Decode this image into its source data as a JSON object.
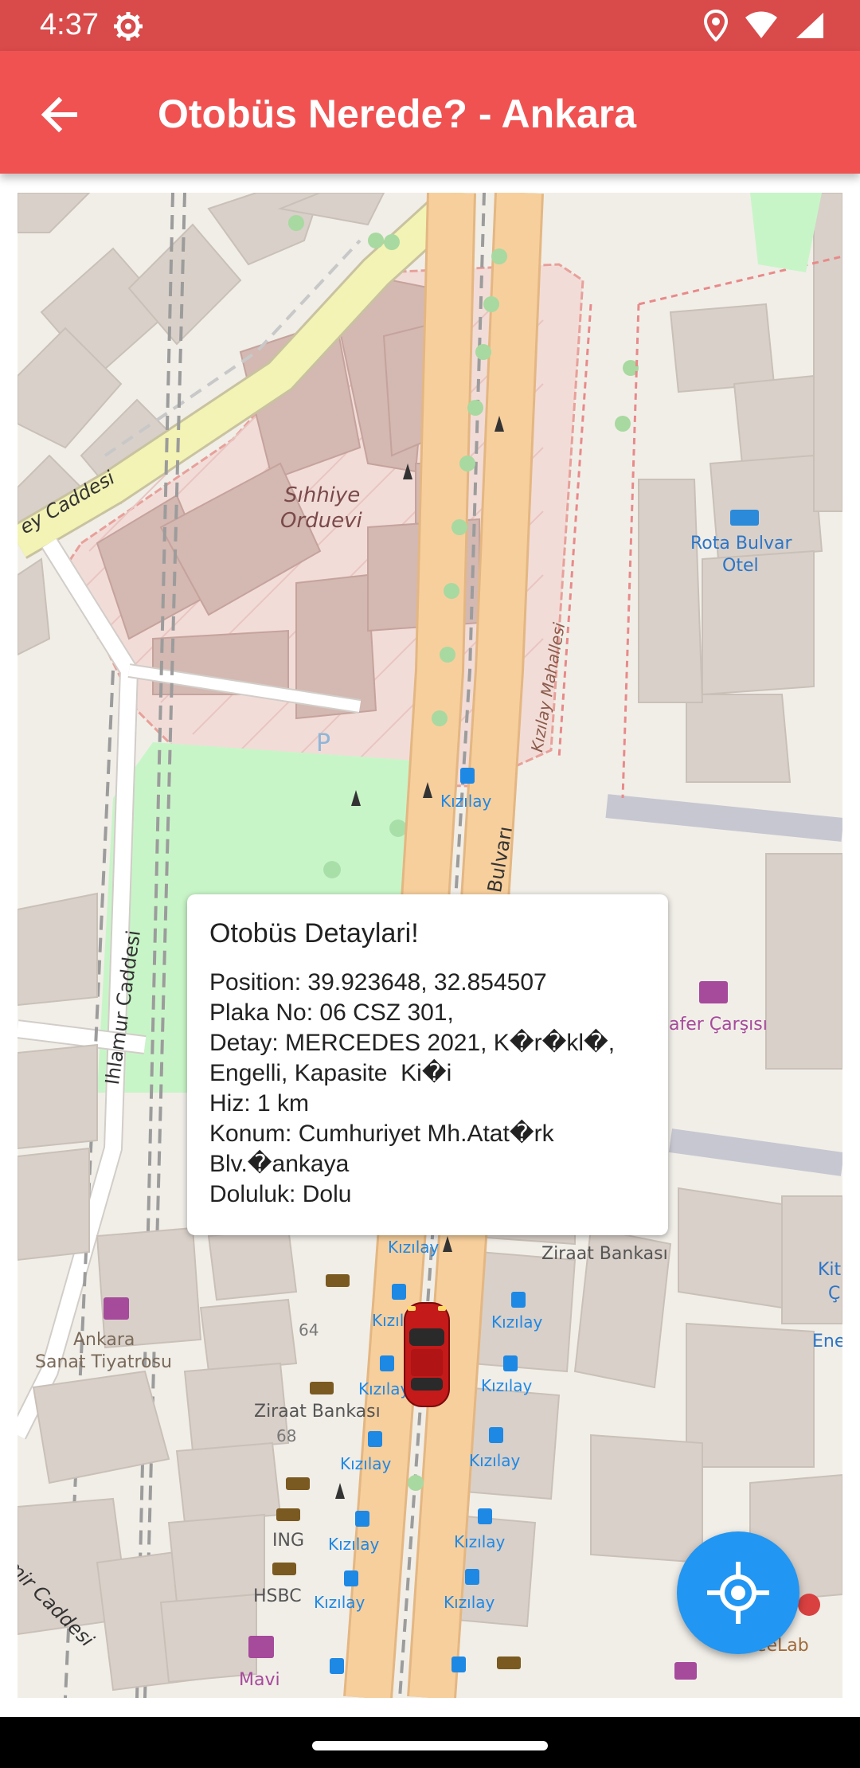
{
  "status_bar": {
    "time": "4:37"
  },
  "app_bar": {
    "title": "Otobüs Nerede? - Ankara"
  },
  "map": {
    "labels": {
      "sihhiye": "Sıhhiye",
      "orduevi": "Orduevi",
      "caddesi_top": "ey Caddesi",
      "rota_line1": "Rota Bulvar",
      "rota_line2": "Otel",
      "mahallesi": "Kızılay Mahallesi",
      "bulvari": "Bulvarı",
      "ihlamur": "Ihlamur Caddesi",
      "zafer": "afer Çarşısı",
      "ziraat_top": "Ziraat Bankası",
      "ziraat_left": "Ziraat Bankası",
      "n64": "64",
      "n68": "68",
      "ankara_line1": "Ankara",
      "ankara_line2": "Sanat Tiyatrosu",
      "ing": "ING",
      "hsbc": "HSBC",
      "mavi": "Mavi",
      "coffeelab": "CoffeeLab",
      "caddesi_bottom": "mir Caddesi",
      "kit": "Kit",
      "c_partial": "Ç",
      "ene": "Ene",
      "parking": "P",
      "kizilay": "Kızılay"
    }
  },
  "popup": {
    "title": "Otobüs Detaylari!",
    "lines": [
      "Position: 39.923648, 32.854507",
      "Plaka No: 06 CSZ 301,",
      "Detay: MERCEDES 2021, K�r�kl�,",
      "Engelli, Kapasite  Ki�i",
      "Hiz: 1 km",
      "Konum: Cumhuriyet Mh.Atat�rk",
      "Blv.�ankaya",
      "Doluluk: Dolu"
    ]
  },
  "colors": {
    "app_bar": "#f05252",
    "status_bar": "#d94a4a",
    "fab": "#2196f3",
    "road_orange": "#f7cf9d",
    "road_yellow": "#f2f3b4",
    "park_green": "#c8f5c8",
    "building": "#d9d0c9",
    "military_zone": "#f2dcd8",
    "bus_stop_blue": "#1e88e5"
  },
  "icons": {
    "back": "arrow-back-icon",
    "settings": "settings-gear-icon",
    "location": "location-pin-icon",
    "wifi": "wifi-icon",
    "signal": "signal-icon",
    "fab": "my-location-icon",
    "car": "car-marker-icon"
  }
}
